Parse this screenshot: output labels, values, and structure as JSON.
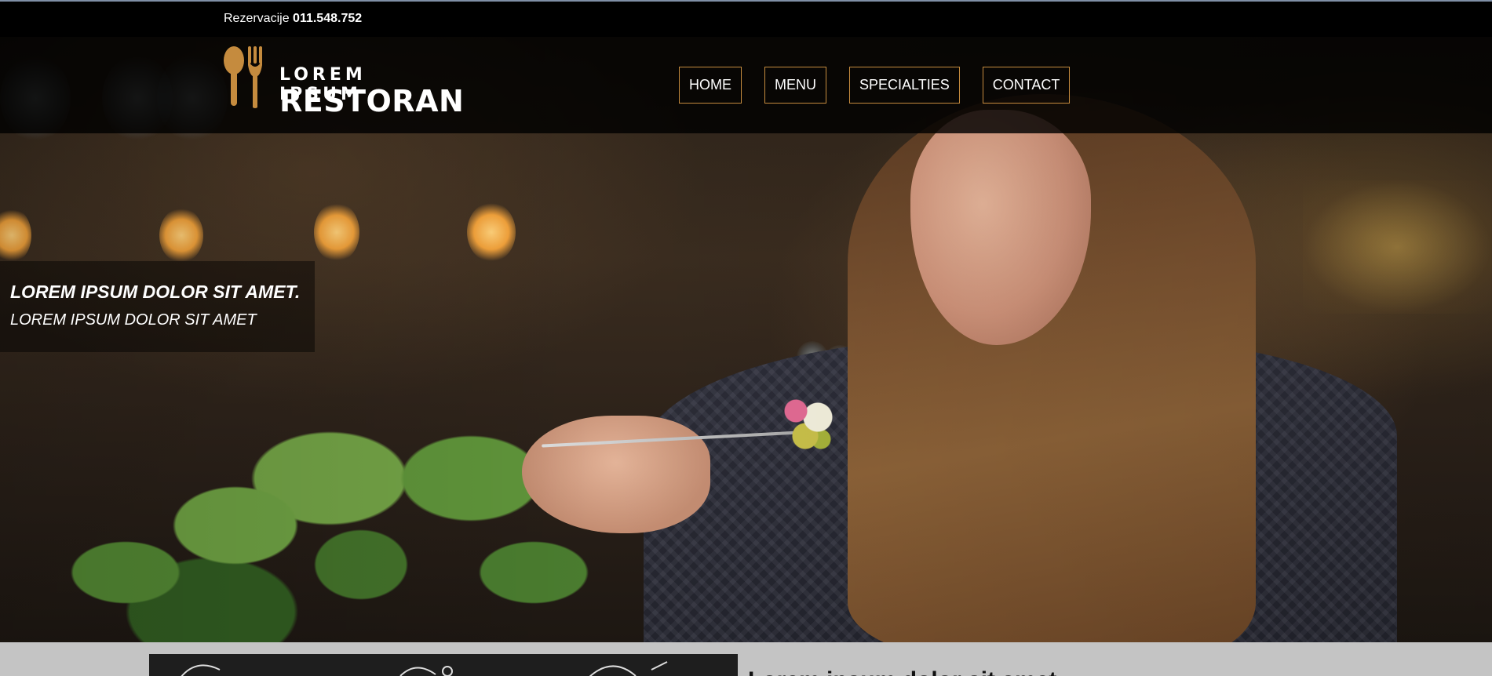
{
  "topbar": {
    "reservation_label": "Rezervacije",
    "phone": "011.548.752"
  },
  "logo": {
    "line1": "LOREM IPSUM",
    "line2": "RESTORAN",
    "icon": "spoon-fork-icon",
    "accent_color": "#c58b3e"
  },
  "nav": {
    "items": [
      {
        "label": "HOME"
      },
      {
        "label": "MENU"
      },
      {
        "label": "SPECIALTIES"
      },
      {
        "label": "CONTACT"
      }
    ],
    "border_color": "#c58b3e"
  },
  "hero": {
    "title": "LOREM IPSUM DOLOR SIT AMET.",
    "subtitle": "LOREM IPSUM DOLOR SIT AMET"
  },
  "section": {
    "heading": "Lorem ipsum dolor sit amet"
  }
}
